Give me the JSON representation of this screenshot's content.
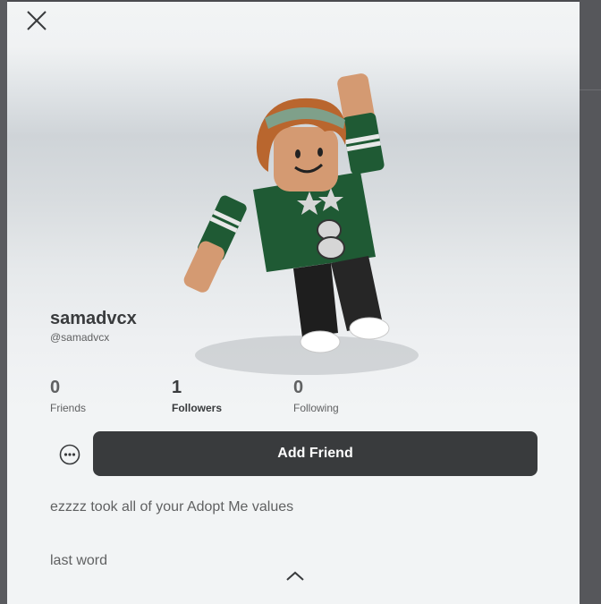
{
  "profile": {
    "display_name": "samadvcx",
    "handle": "@samadvcx"
  },
  "stats": [
    {
      "value": "0",
      "label": "Friends"
    },
    {
      "value": "1",
      "label": "Followers"
    },
    {
      "value": "0",
      "label": "Following"
    }
  ],
  "actions": {
    "add_friend_label": "Add Friend",
    "more_icon": "more-options-icon",
    "close_icon": "close-icon",
    "collapse_icon": "chevron-up-icon"
  },
  "bio": {
    "line1": "ezzzz took all of your Adopt Me values",
    "line2": "last word"
  },
  "colors": {
    "button_bg": "#393b3d",
    "button_text": "#ffffff",
    "panel_bg": "#f2f4f5",
    "text_primary": "#393b3d",
    "text_secondary": "#606162"
  }
}
